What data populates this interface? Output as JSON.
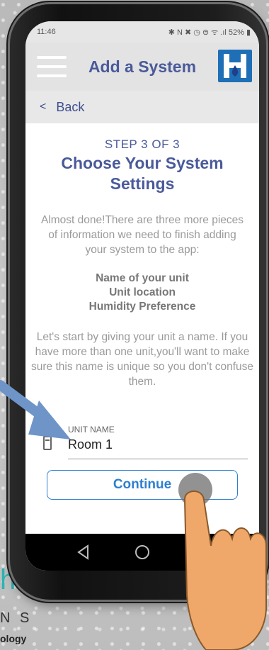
{
  "status": {
    "time": "11:46",
    "icons": "✱ N ✖ ◷ ⊜ ᯤ .ıl 52% ▮"
  },
  "header": {
    "title": "Add a System"
  },
  "nav": {
    "back_label": "Back"
  },
  "main": {
    "step": "STEP 3 OF 3",
    "heading": "Choose Your System Settings",
    "intro": "Almost done!There are three more pieces of information we need to finish adding your system to the app:",
    "items": [
      "Name of your unit",
      "Unit location",
      "Humidity Preference"
    ],
    "outro": "Let's start by giving your unit a name. If you have more than one unit,you'll want to make sure this name is unique so you don't confuse them.",
    "unit_name_label": "UNIT NAME",
    "unit_name_value": "Room 1",
    "continue_label": "Continue"
  },
  "background_brand": {
    "letter": "h",
    "line2": "N S",
    "line3": "ology"
  },
  "colors": {
    "brand_blue": "#4a5a9a",
    "accent": "#2e7fd0",
    "teal": "#2bb5b2"
  }
}
